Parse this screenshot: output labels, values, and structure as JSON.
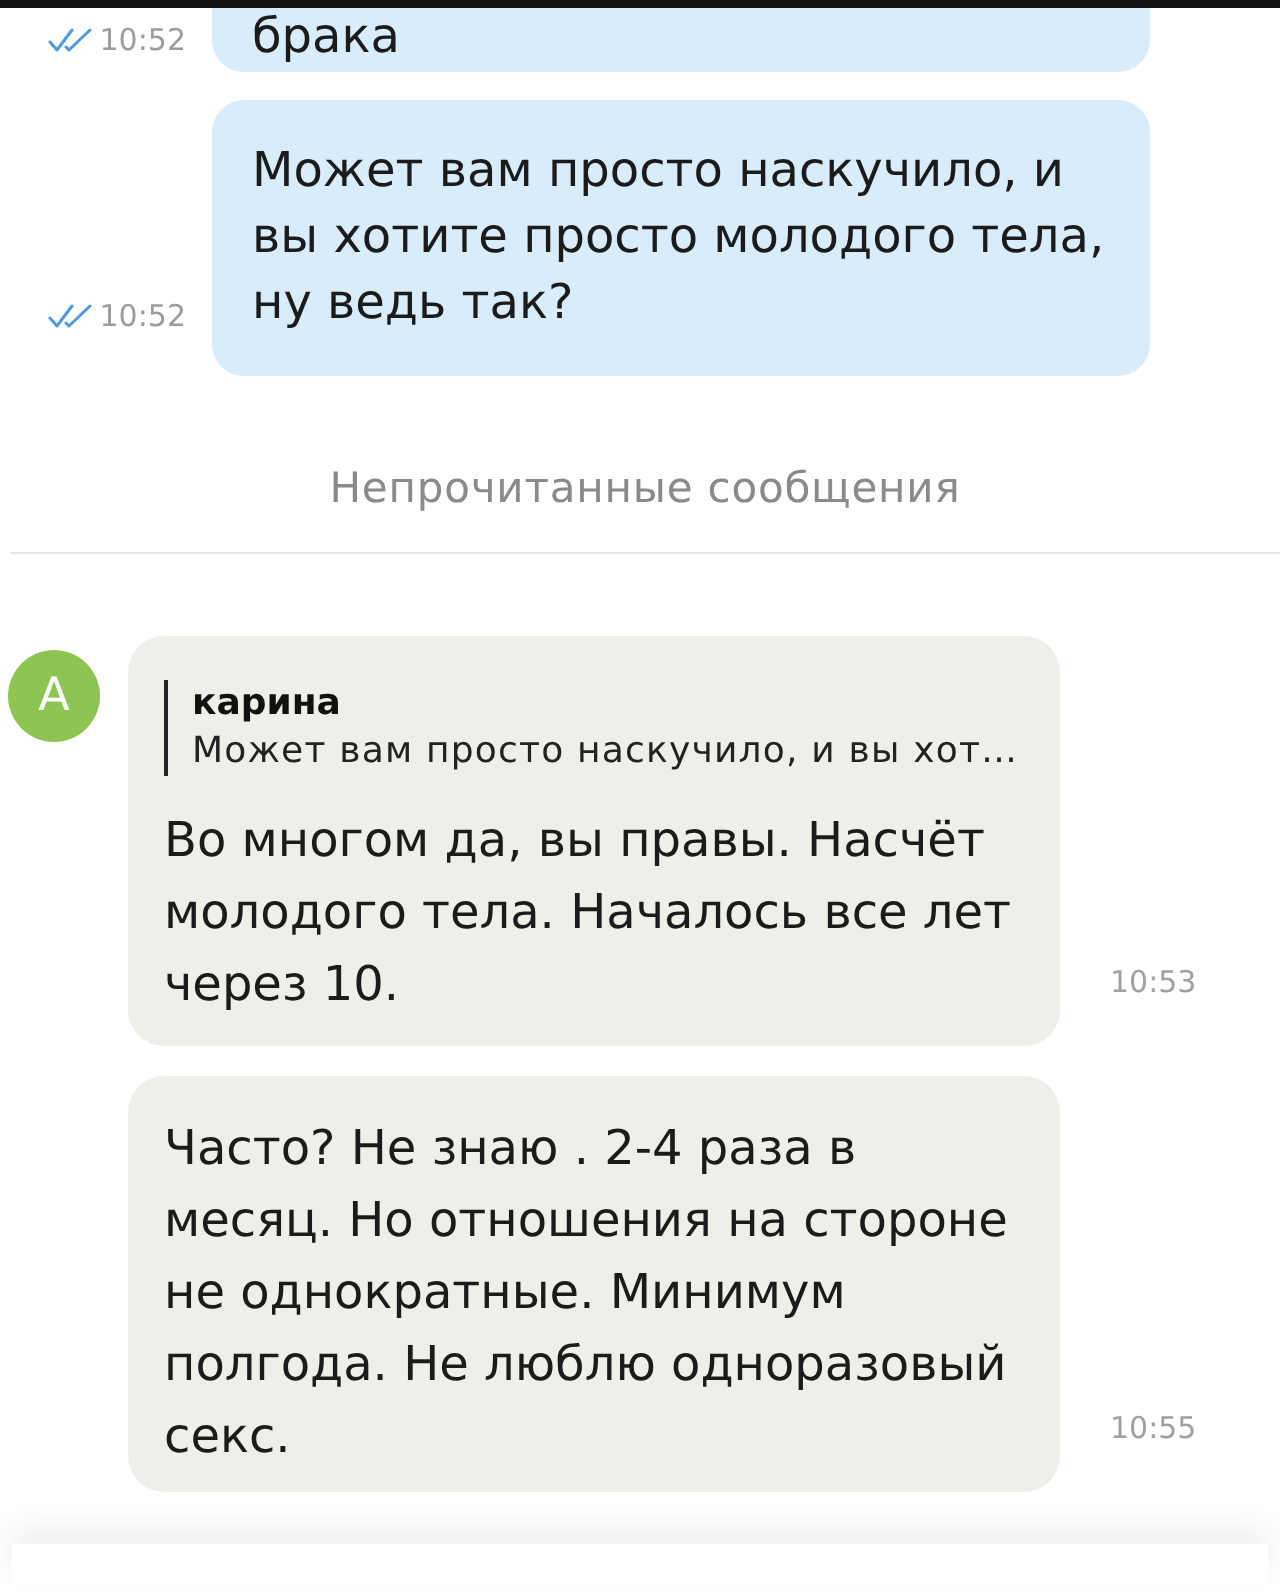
{
  "outgoing_messages": [
    {
      "text": "брака",
      "time": "10:52",
      "read": true
    },
    {
      "text": "Может вам просто наскучило, и вы хотите просто молодого тела, ну ведь так?",
      "time": "10:52",
      "read": true
    }
  ],
  "unread_divider": {
    "label": "Непрочитанные сообщения"
  },
  "incoming_group": {
    "avatar": {
      "letter": "A"
    },
    "messages": [
      {
        "reply": {
          "author": "карина",
          "text": "Может вам просто наскучило, и вы хот…"
        },
        "text": "Во многом да, вы правы. Насчёт молодого тела. Началось все лет через 10.",
        "time": "10:53"
      },
      {
        "text": "Часто? Не знаю . 2-4 раза в месяц. Но отношения на стороне не однократные. Минимум полгода. Не люблю одноразовый секс.",
        "time": "10:55"
      }
    ]
  }
}
